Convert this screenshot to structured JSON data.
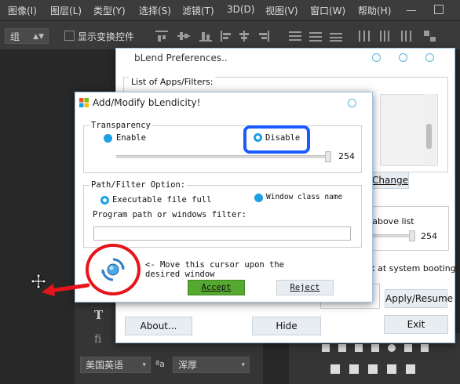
{
  "menubar": [
    "图像(I)",
    "图层(L)",
    "类型(Y)",
    "选择(S)",
    "滤镜(T)",
    "3D(D)",
    "视图(V)",
    "窗口(W)",
    "帮助(H)"
  ],
  "options": {
    "group_select": "组",
    "show_transform": "显示变换控件"
  },
  "bottom_bar": {
    "language": "美国英语",
    "aa_label": "ªa",
    "aa_method": "浑厚",
    "type_t": "T",
    "fi": "fi"
  },
  "prefs": {
    "title": "bLend Preferences..",
    "list_label": "List of Apps/Filters:",
    "change": "Change",
    "above_list": "o above list",
    "value": "254",
    "startup": "art at system booting.",
    "apply": "Apply/Resume",
    "about": "About...",
    "hide": "Hide",
    "exit": "Exit"
  },
  "dialog": {
    "title": "Add/Modify bLendicity!",
    "transparency": "Transparency",
    "enable": "Enable",
    "disable": "Disable",
    "value": "254",
    "path_filter": "Path/Filter Option:",
    "exec_full": "Executable file full",
    "window_class": "Window class name",
    "program_path": "Program path or windows filter:",
    "cursor_hint": "<- Move this cursor upon the desired window",
    "accept": "Accept",
    "reject": "Reject"
  },
  "colors": {
    "accent": "#1ea0e6",
    "highlight": "#1a5bff",
    "annotation": "#e8141b",
    "accept": "#55a830"
  }
}
